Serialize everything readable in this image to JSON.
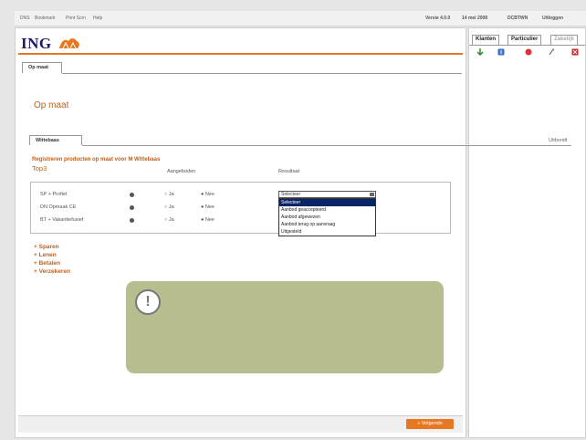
{
  "top_links": [
    "DNS",
    "Bookmark",
    "Print Scrn",
    "Help"
  ],
  "top_status": [
    "Versie 4.0.0",
    "14 mei 2008",
    "DCBTWN",
    "Uitloggen"
  ],
  "brand": {
    "name": "ING",
    "logo_icon": "lion-icon",
    "accent": "#e87722"
  },
  "tabs": {
    "main": "Op maat",
    "sub": "Wittebaas"
  },
  "page_title": "Op maat",
  "right_link": "Uitbreidt",
  "section": {
    "heading": "Registreren producten op maat voor M Wittebaas",
    "subtitle": "Top3",
    "columns": [
      "Aangeboden",
      "Resultaat"
    ],
    "rows": [
      {
        "product": "SP + Profiel",
        "opt_ja": "Ja",
        "opt_nee": "Nee"
      },
      {
        "product": "DN Opmaak CE",
        "opt_ja": "Ja",
        "opt_nee": "Nee"
      },
      {
        "product": "BT + Vakantiefusief",
        "opt_ja": "Ja",
        "opt_nee": "Nee"
      }
    ],
    "dropdown": {
      "selected": "Selecteer",
      "options": [
        "Selecteer",
        "Aanbod geaccepteerd",
        "Aanbod afgewezen",
        "Aanbod terug op aanvraag",
        "Uitgesteld"
      ]
    }
  },
  "sidebar_links": [
    "Sparen",
    "Lenen",
    "Betalen",
    "Verzekeren"
  ],
  "notice_icon": "exclamation-icon",
  "next_button": "Volgende",
  "right_tabs": [
    "Klanten",
    "Particulier",
    "Zakelijk"
  ],
  "right_icons": [
    "arrow-down-icon",
    "info-icon",
    "stop-icon",
    "pin-icon",
    "close-icon"
  ]
}
